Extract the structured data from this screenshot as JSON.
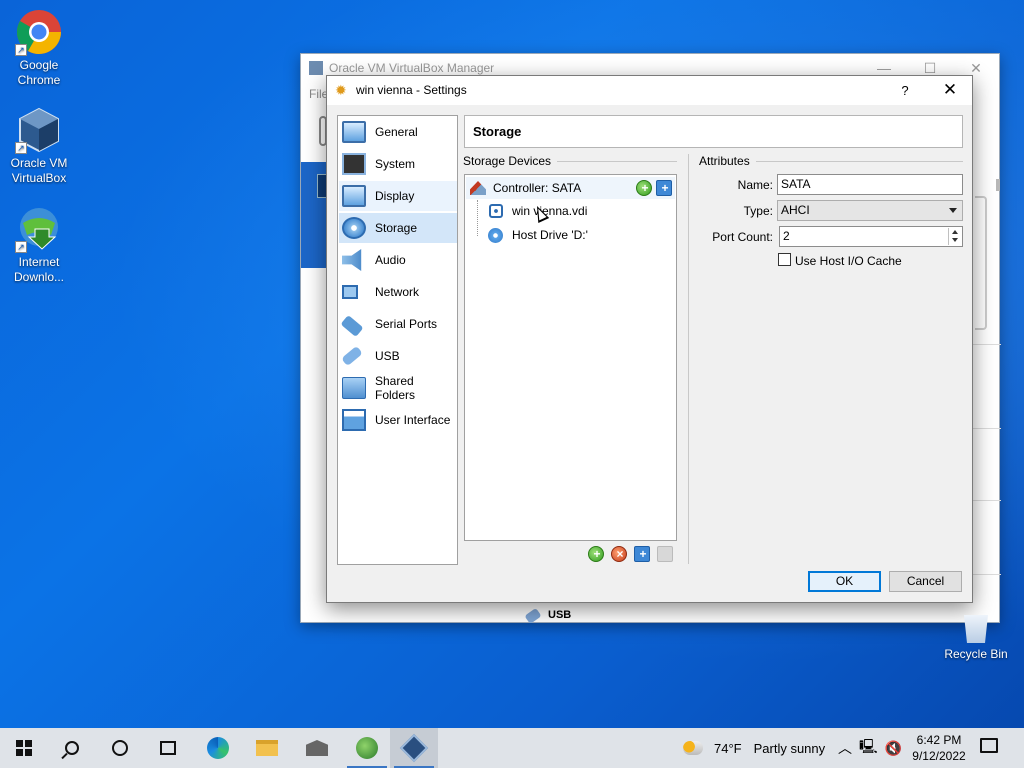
{
  "desktop": {
    "icons": [
      {
        "label": "Google Chrome",
        "icon": "chrome-icon"
      },
      {
        "label": "Oracle VM VirtualBox",
        "icon": "virtualbox-icon"
      },
      {
        "label": "Internet Downlo...",
        "icon": "idm-icon"
      }
    ],
    "recycle_bin": "Recycle Bin"
  },
  "manager": {
    "title": "Oracle VM VirtualBox Manager",
    "menu_file": "File",
    "usb_label": "USB",
    "controls": {
      "minimize": "—",
      "maximize": "☐",
      "close": "✕"
    }
  },
  "dialog": {
    "title": "win vienna - Settings",
    "help": "?",
    "close": "✕",
    "categories": [
      {
        "label": "General",
        "icon": "monitor-icon"
      },
      {
        "label": "System",
        "icon": "chip-icon"
      },
      {
        "label": "Display",
        "icon": "display-icon"
      },
      {
        "label": "Storage",
        "icon": "storage-icon"
      },
      {
        "label": "Audio",
        "icon": "audio-icon"
      },
      {
        "label": "Network",
        "icon": "network-icon"
      },
      {
        "label": "Serial Ports",
        "icon": "serial-icon"
      },
      {
        "label": "USB",
        "icon": "usb-icon"
      },
      {
        "label": "Shared Folders",
        "icon": "folder-icon"
      },
      {
        "label": "User Interface",
        "icon": "ui-icon"
      }
    ],
    "selected_category": "Storage",
    "page_title": "Storage",
    "storage_devices_label": "Storage Devices",
    "controller": "Controller: SATA",
    "devices": [
      {
        "label": "win vienna.vdi",
        "icon": "hdd-icon"
      },
      {
        "label": "Host Drive 'D:'",
        "icon": "optical-disc-icon"
      }
    ],
    "attributes_label": "Attributes",
    "attributes": {
      "name_label": "Name:",
      "name_value": "SATA",
      "type_label": "Type:",
      "type_value": "AHCI",
      "port_count_label": "Port Count:",
      "port_count_value": "2",
      "host_io_cache_label": "Use Host I/O Cache",
      "host_io_cache_checked": false
    },
    "ok": "OK",
    "cancel": "Cancel"
  },
  "taskbar": {
    "weather_temp": "74°F",
    "weather_text": "Partly sunny",
    "time": "6:42 PM",
    "date": "9/12/2022",
    "accent": "#3a76c4"
  }
}
